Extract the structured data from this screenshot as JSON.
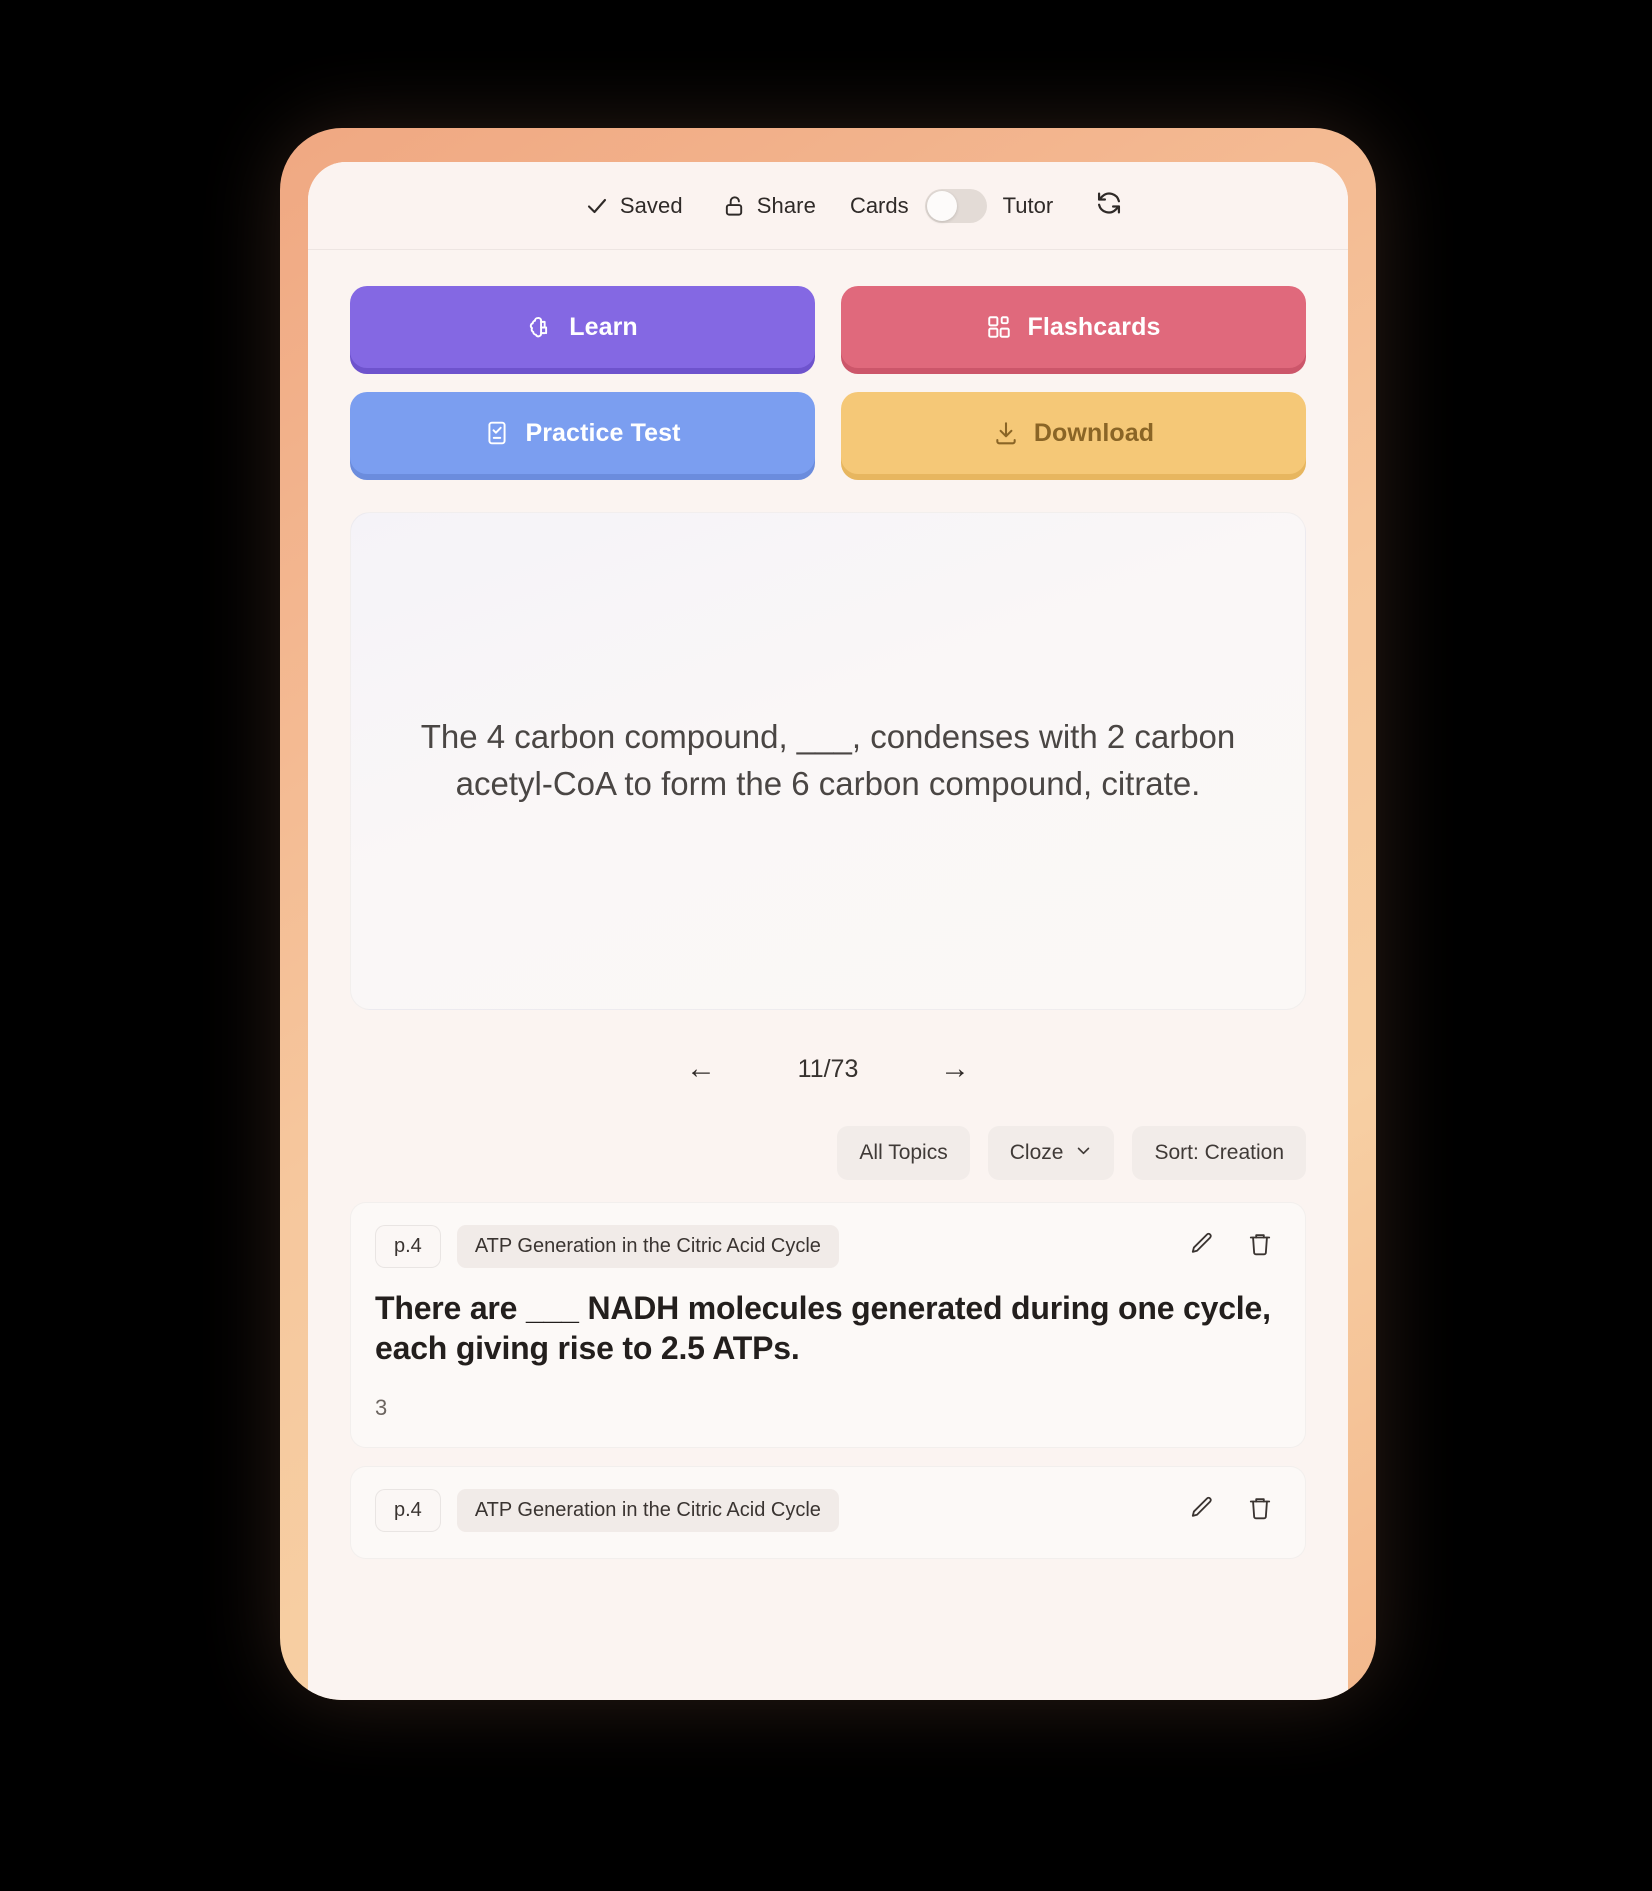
{
  "topbar": {
    "saved_label": "Saved",
    "saved_icon": "check-icon",
    "share_label": "Share",
    "share_icon": "unlock-icon",
    "cards_label": "Cards",
    "tutor_label": "Tutor",
    "toggle_state": "cards",
    "refresh_icon": "refresh-icon"
  },
  "actions": [
    {
      "label": "Learn",
      "icon": "brain-icon",
      "color": "#8468e3"
    },
    {
      "label": "Flashcards",
      "icon": "blocks-icon",
      "color": "#e0697c"
    },
    {
      "label": "Practice Test",
      "icon": "checklist-icon",
      "color": "#7b9ef0"
    },
    {
      "label": "Download",
      "icon": "download-icon",
      "color": "#f5c877"
    }
  ],
  "flashcard": {
    "text": "The 4 carbon compound, ___, condenses with 2 carbon acetyl-CoA to form the 6 carbon compound, citrate."
  },
  "nav": {
    "prev_icon": "arrow-left-icon",
    "next_icon": "arrow-right-icon",
    "counter": "11/73",
    "current": 11,
    "total": 73
  },
  "filters": {
    "topics_label": "All Topics",
    "type_label": "Cloze",
    "type_icon": "chevron-down-icon",
    "sort_label": "Sort: Creation"
  },
  "list": [
    {
      "page": "p.4",
      "topic": "ATP Generation in the Citric Acid Cycle",
      "question": "There are ___ NADH molecules generated during one cycle, each giving rise to 2.5 ATPs.",
      "answer": "3",
      "edit_icon": "pencil-icon",
      "delete_icon": "trash-icon"
    },
    {
      "page": "p.4",
      "topic": "ATP Generation in the Citric Acid Cycle",
      "question": "",
      "answer": "",
      "edit_icon": "pencil-icon",
      "delete_icon": "trash-icon"
    }
  ]
}
